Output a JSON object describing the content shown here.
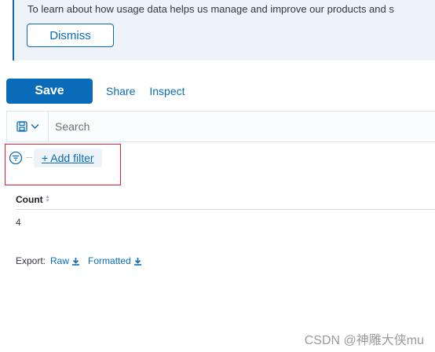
{
  "callout": {
    "text": "To learn about how usage data helps us manage and improve our products and s",
    "dismiss_label": "Dismiss"
  },
  "top_nav": {
    "save_label": "Save",
    "share_label": "Share",
    "inspect_label": "Inspect"
  },
  "query_bar": {
    "saved_query_icon": "save-disk-icon",
    "chevron_icon": "chevron-down-icon",
    "search_placeholder": "Search"
  },
  "filters": {
    "filter_icon": "filter-icon",
    "add_filter_label": "+ Add filter"
  },
  "table": {
    "columns": [
      "Count"
    ],
    "rows": [
      [
        "4"
      ]
    ]
  },
  "export": {
    "label": "Export:",
    "raw_label": "Raw",
    "formatted_label": "Formatted"
  },
  "watermark": "CSDN @神雕大侠mu",
  "colors": {
    "primary": "#0a6bb8",
    "callout_bg": "#eef3fa",
    "highlight": "#e0242d"
  }
}
